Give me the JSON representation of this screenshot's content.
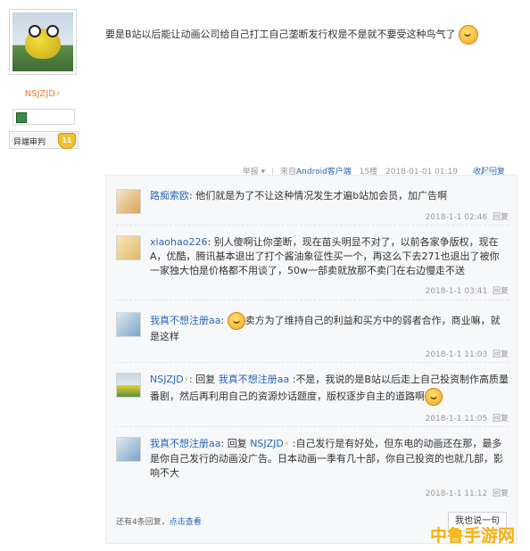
{
  "profile": {
    "username": "NSJZJD",
    "lightning_icon": "lightning-icon",
    "rank_label": "异端审判",
    "rank_level": "11"
  },
  "post": {
    "text": "要是B站以后能让动画公司给自己打工自己垄断发行权是不是就不要受这种鸟气了"
  },
  "meta": {
    "report": "举报",
    "source": "来自Android客户端",
    "floor": "15楼",
    "datetime": "2018-01-01 01:19",
    "collapse": "收起回复"
  },
  "replies": [
    {
      "user": "路痴索欧",
      "text": "他们就是为了不让这种情况发生才遍b站加会员，加广告啊",
      "time": "2018-1-1 02:46",
      "reply_label": "回复"
    },
    {
      "user": "xiaohao226",
      "text": "别人傻啊让你垄断，现在苗头明显不对了，以前各家争版权，现在A，优酷，腾讯基本退出了打个酱油象征性买一个，再这么下去271也退出了被你一家独大怕是价格都不用谈了，50w一部卖就放那不卖门在右边慢走不送",
      "time": "2018-1-1 03:41",
      "reply_label": "回复"
    },
    {
      "user": "我真不想注册aa",
      "text": "卖方为了维持自己的利益和买方中的弱者合作，商业嘛，就是这样",
      "time": "2018-1-1 11:03",
      "reply_label": "回复"
    },
    {
      "user": "NSJZJD",
      "prefix": "回复",
      "target": "我真不想注册aa",
      "text": "不是，我说的是B站以后走上自己投资制作高质量番剧，然后再利用自己的资源炒话题度，版权逐步自主的道路啊",
      "time": "2018-1-1 11:05",
      "reply_label": "回复"
    },
    {
      "user": "我真不想注册aa",
      "prefix": "回复",
      "target": "NSJZJD",
      "text": "自己发行是有好处，但东电的动画还在那，最多是你自己发行的动画没广告。日本动画一季有几十部，你自己投资的也就几部，影响不大",
      "time": "2018-1-1 11:12",
      "reply_label": "回复"
    }
  ],
  "footer": {
    "more_prefix": "还有4条回复，",
    "more_link": "点击查看",
    "say_button": "我也说一句"
  },
  "watermark": "中鲁手游网"
}
